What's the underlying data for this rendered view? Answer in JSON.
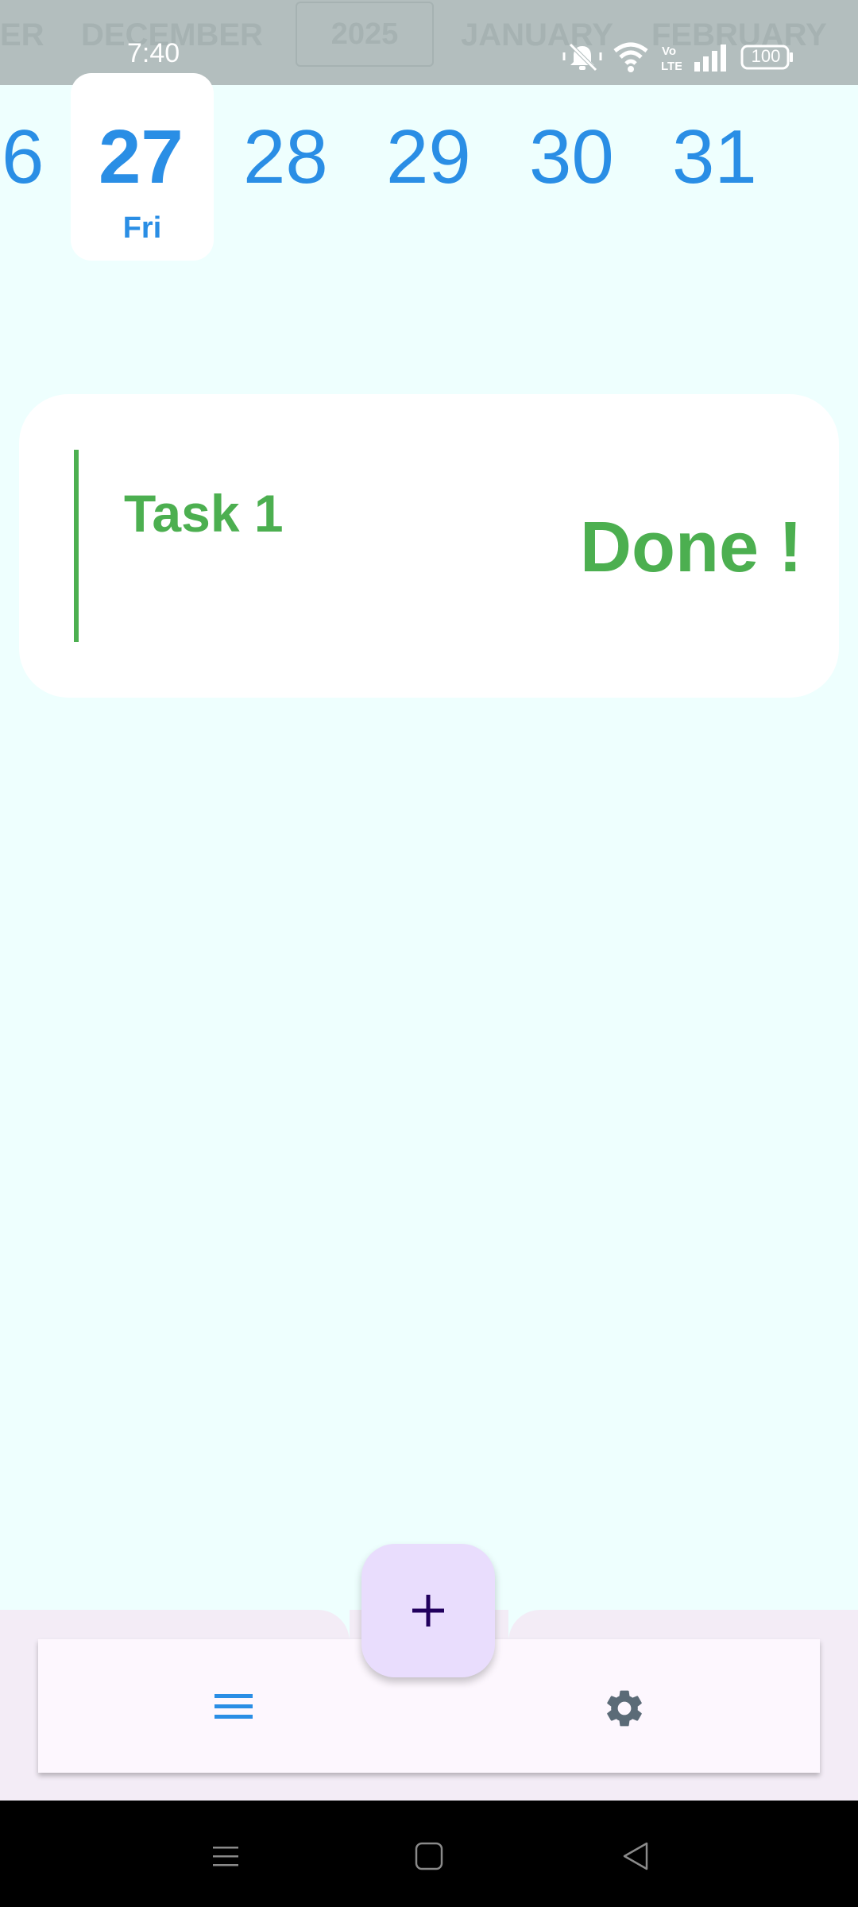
{
  "status_bar": {
    "time": "7:40",
    "battery": "100",
    "network_label": "Vo LTE"
  },
  "month_strip": {
    "months": [
      "ER",
      "DECEMBER",
      "JANUARY",
      "FEBRUARY"
    ],
    "year": "2025"
  },
  "date_strip": {
    "days": [
      {
        "number": "6"
      },
      {
        "number": "27",
        "weekday": "Fri",
        "selected": true
      },
      {
        "number": "28"
      },
      {
        "number": "29"
      },
      {
        "number": "30"
      },
      {
        "number": "31"
      }
    ]
  },
  "task": {
    "title": "Task 1",
    "status": "Done !",
    "accent_color": "#4caf50"
  },
  "bottom_bar": {
    "left_icon": "menu-icon",
    "center_icon": "plus-icon",
    "right_icon": "gear-icon"
  },
  "system_nav": {
    "icons": [
      "recents-icon",
      "home-icon",
      "back-icon"
    ]
  },
  "colors": {
    "background": "#eefffe",
    "accent_blue": "#2a8ee5",
    "task_green": "#4caf50",
    "fab": "#e9ddfd",
    "status_bar": "#b3bebe"
  }
}
